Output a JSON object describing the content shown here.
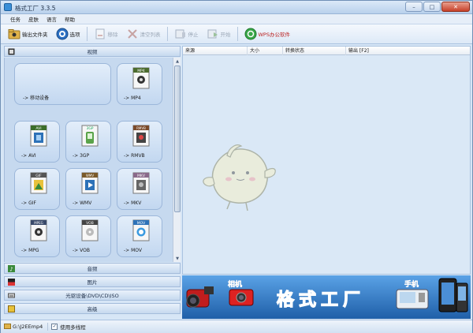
{
  "window": {
    "title": "格式工厂 3.3.5",
    "minimize": "–",
    "maximize": "□",
    "close": "✕"
  },
  "menu": [
    "任务",
    "皮肤",
    "语言",
    "帮助"
  ],
  "toolbar": {
    "output_folder": "输出文件夹",
    "options": "选项",
    "remove": "移除",
    "clear_list": "清空列表",
    "stop": "停止",
    "start": "开始",
    "wps": "WPS办公软件"
  },
  "categories": {
    "video": "视频",
    "audio": "音频",
    "picture": "图片",
    "rom": "光驱设备\\DVD\\CD\\ISO",
    "advanced": "高级"
  },
  "tiles": [
    {
      "label": "-> 移动设备",
      "icon": ""
    },
    {
      "label": "-> MP4",
      "icon": "MP4"
    },
    {
      "label": "-> AVI",
      "icon": "AVI"
    },
    {
      "label": "-> 3GP",
      "icon": "3GP"
    },
    {
      "label": "-> RMVB",
      "icon": "RMVB"
    },
    {
      "label": "-> GIF",
      "icon": "GIF"
    },
    {
      "label": "-> WMV",
      "icon": "WMV"
    },
    {
      "label": "-> MKV",
      "icon": "MKV"
    },
    {
      "label": "-> MPG",
      "icon": "MPEG"
    },
    {
      "label": "-> VOB",
      "icon": "VOB"
    },
    {
      "label": "-> MOV",
      "icon": "MOV"
    }
  ],
  "list_columns": [
    "来源",
    "大小",
    "转换状态",
    "输出 [F2]"
  ],
  "banner": {
    "camera_text": "相机",
    "brand_text": "格式工厂",
    "phone_text": "手机"
  },
  "status": {
    "output_path": "G:\\J2EEmp4",
    "multithread_label": "使用多线程",
    "multithread_checked": true
  },
  "colors": {
    "accent": "#2f7cc8",
    "brand_orange": "#ff7a1a",
    "panel": "#c6d9ef"
  }
}
